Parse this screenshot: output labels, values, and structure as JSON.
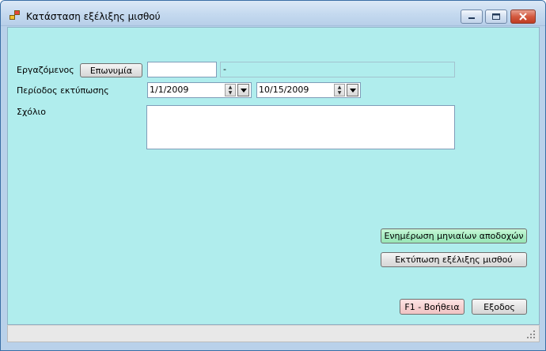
{
  "window": {
    "title": "Κατάσταση εξέλιξης μισθού"
  },
  "form": {
    "employee_label": "Εργαζόμενος",
    "name_button": "Επωνυμία",
    "employee_code": "",
    "employee_name": "-",
    "period_label": "Περίοδος εκτύπωσης",
    "date_from": "1/1/2009",
    "date_to": "10/15/2009",
    "comment_label": "Σχόλιο",
    "comment_value": ""
  },
  "actions": {
    "update_button": "Ενημέρωση μηνιαίων αποδοχών",
    "print_button": "Εκτύπωση εξέλιξης μισθού",
    "help_button": "F1 - Βοήθεια",
    "exit_button": "Εξοδος"
  },
  "colors": {
    "client_bg": "#b0eded",
    "update_button": "#a9eec4",
    "help_button": "#f6d2d2"
  }
}
